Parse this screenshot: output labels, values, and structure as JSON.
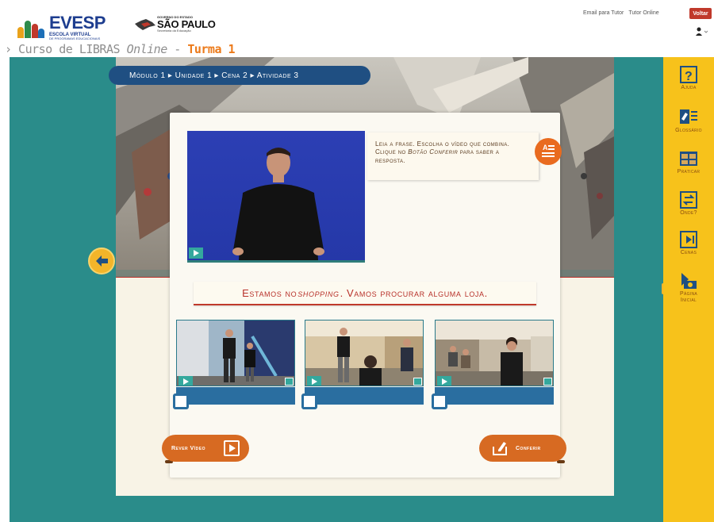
{
  "header": {
    "evesp_logo": {
      "title": "EVESP",
      "subtitle": "ESCOLA VIRTUAL",
      "subtitle2": "DE PROGRAMAS EDUCACIONAIS"
    },
    "sp_logo": {
      "gov": "GOVERNO DO ESTADO",
      "title": "SÃO PAULO",
      "secretaria": "Secretaria da Educação"
    },
    "links": {
      "email_tutor": "Email para Tutor",
      "tutor_online": "Tutor Online"
    },
    "voltar": "Voltar",
    "breadcrumb": {
      "prefix": "› Curso de LIBRAS ",
      "online": "Online",
      "dash": " - ",
      "turma": "Turma 1"
    }
  },
  "module_nav": "Módulo 1 ▸ Unidade 1 ▸ Cena 2 ▸ Atividade 3",
  "instructions": {
    "part1": "Leia a frase. Escolha o vídeo que combina. Clique no ",
    "emphasis": "Botão Conferir",
    "part2": " para saber a resposta."
  },
  "phrase": {
    "part1": "Estamos no ",
    "emphasis": "shopping",
    "part2": ". Vamos procurar alguma loja."
  },
  "buttons": {
    "rever_video": "Rever Vídeo",
    "conferir": "Conferir"
  },
  "right_menu": [
    {
      "label": "Ajuda",
      "icon": "help-icon"
    },
    {
      "label": "Glossário",
      "icon": "glossary-icon"
    },
    {
      "label": "Praticar",
      "icon": "practice-icon"
    },
    {
      "label": "Onde?",
      "icon": "where-icon"
    },
    {
      "label": "Cenas",
      "icon": "scenes-icon"
    },
    {
      "label": "Página Inicial",
      "icon": "home-icon"
    }
  ],
  "colors": {
    "teal_background": "#2a8c8a",
    "menu_yellow": "#f7c21b",
    "accent_orange": "#d76a22",
    "nav_blue": "#1f4f82",
    "phrase_red": "#b8312a"
  }
}
